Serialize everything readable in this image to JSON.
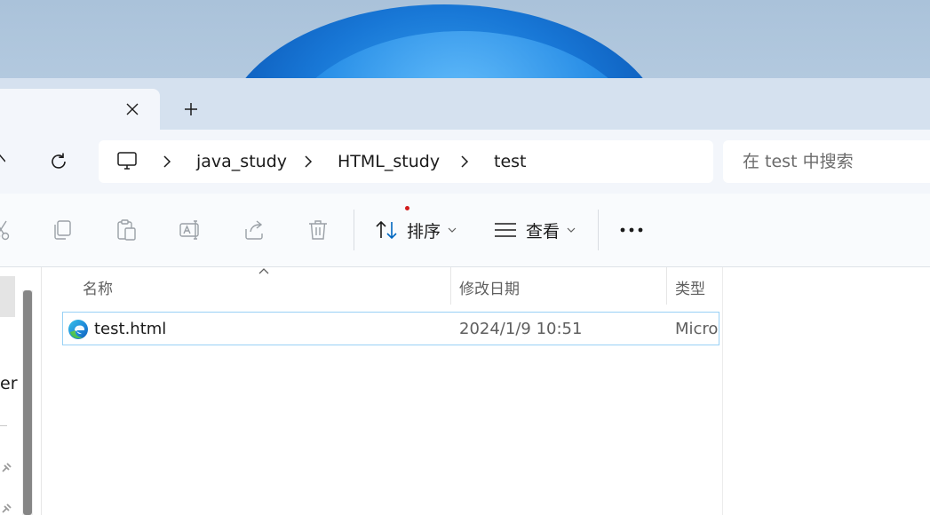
{
  "tabs": {
    "new_tab_glyph": "+"
  },
  "address": {
    "crumbs": [
      "java_study",
      "HTML_study",
      "test"
    ],
    "search_placeholder": "在 test 中搜索"
  },
  "toolbar": {
    "sort_label": "排序",
    "view_label": "查看",
    "more_glyph": "•••",
    "icons": [
      "cut-icon",
      "copy-icon",
      "paste-icon",
      "rename-icon",
      "share-icon",
      "delete-icon"
    ]
  },
  "nav": {
    "partial_text": "er"
  },
  "columns": {
    "name": "名称",
    "date": "修改日期",
    "type": "类型"
  },
  "files": [
    {
      "name": "test.html",
      "modified": "2024/1/9 10:51",
      "type": "Micro"
    }
  ],
  "colors": {
    "accent": "#0067c0",
    "selection_border": "#99d1f5"
  }
}
